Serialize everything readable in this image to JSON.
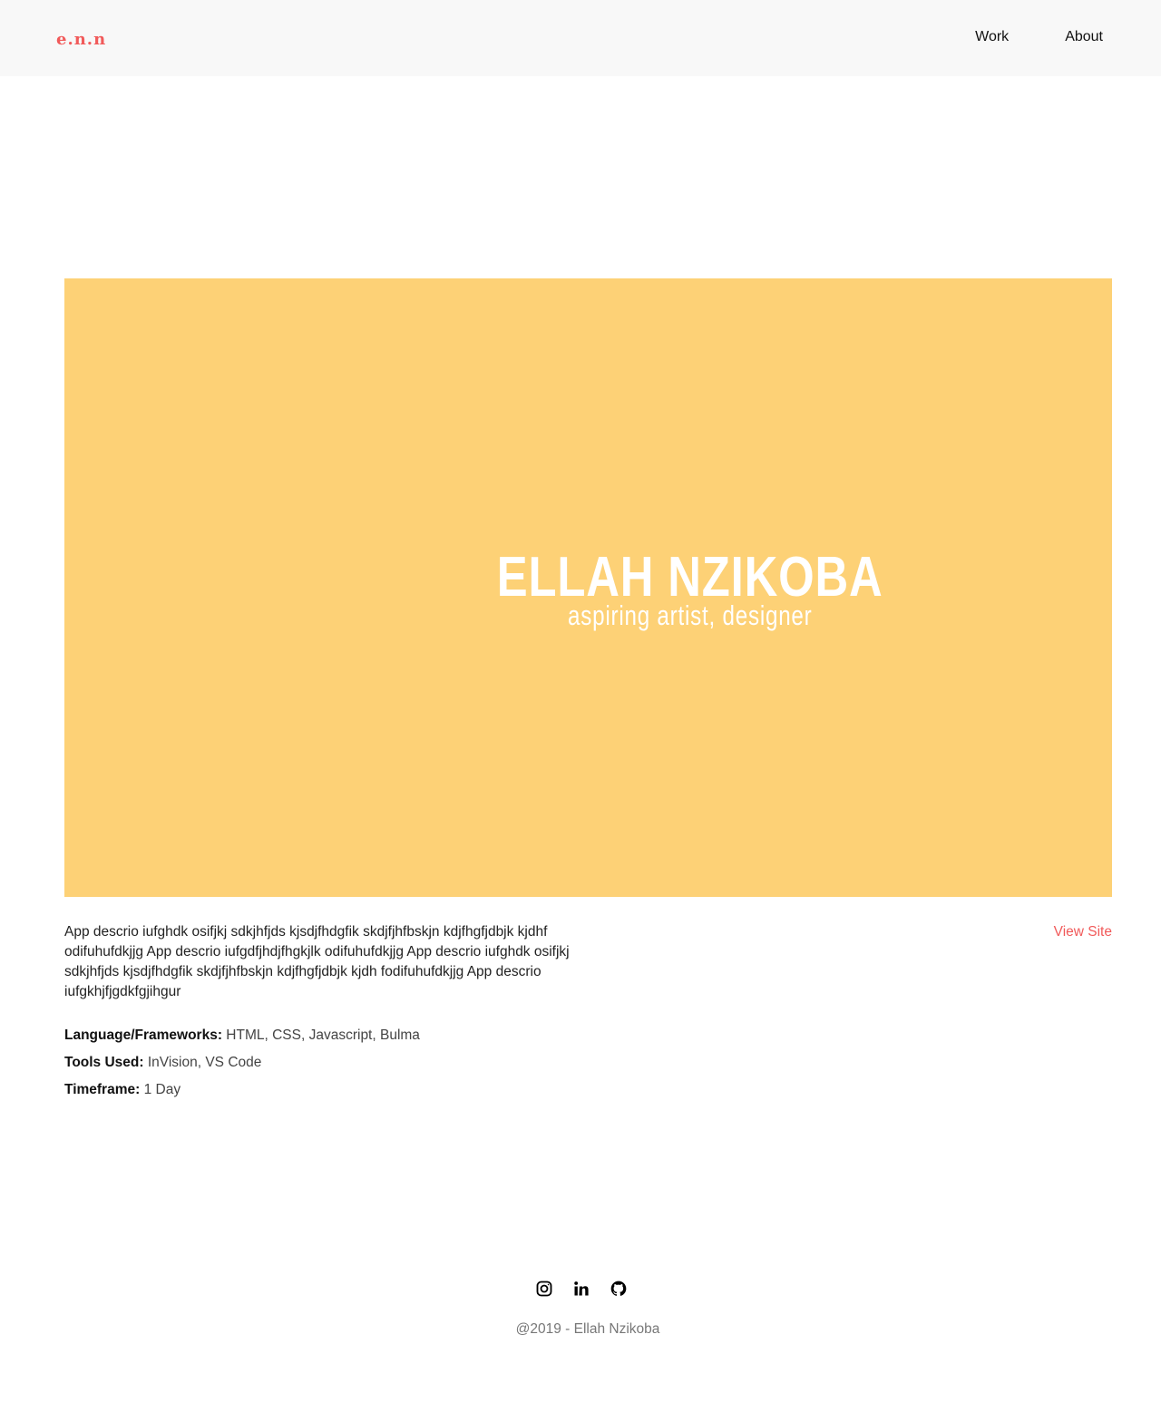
{
  "nav": {
    "logo": "e.n.n",
    "links": [
      "Work",
      "About"
    ]
  },
  "hero": {
    "title": "ELLAH NZIKOBA",
    "subtitle": "aspiring artist, designer",
    "background_color": "#fdd176"
  },
  "project": {
    "description": "App descrio iufghdk osifjkj sdkjhfjds kjsdjfhdgfik skdjfjhfbskjn kdjfhgfjdbjk kjdhf odifuhufdkjjg App descrio iufgdfjhdjfhgkjlk odifuhufdkjjg App descrio iufghdk osifjkj sdkjhfjds kjsdjfhdgfik skdjfjhfbskjn kdjfhgfjdbjk kjdh fodifuhufdkjjg App descrio iufgkhjfjgdkfgjihgur",
    "view_site": "View Site",
    "details": [
      {
        "label": "Language/Frameworks:",
        "value": " HTML, CSS, Javascript, Bulma"
      },
      {
        "label": "Tools Used:",
        "value": " InVision, VS Code"
      },
      {
        "label": "Timeframe:",
        "value": " 1 Day"
      }
    ]
  },
  "footer": {
    "icons": [
      "instagram-icon",
      "linkedin-icon",
      "github-icon"
    ],
    "copyright": "@2019 - Ellah Nzikoba"
  },
  "colors": {
    "accent": "#f15a5a",
    "navbar_bg": "#f8f8f8"
  }
}
